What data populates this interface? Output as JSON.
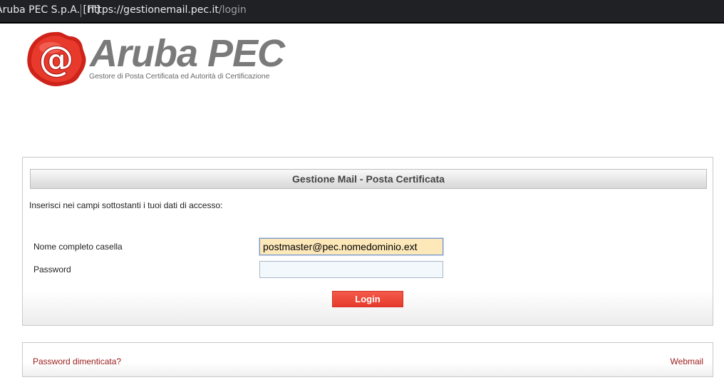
{
  "browser": {
    "site_name": "Aruba PEC S.p.A. [IT]",
    "url_host": "https://gestionemail.pec.it",
    "url_path": "/login"
  },
  "logo": {
    "icon": "aruba-seal-at-icon",
    "seal_glyph": "@",
    "wordmark": "Aruba PEC",
    "tagline": "Gestore di Posta Certificata ed Autorità di Certificazione",
    "seal_color": "#d9261c"
  },
  "login_panel": {
    "title": "Gestione Mail - Posta Certificata",
    "intro": "Inserisci nei campi sottostanti i tuoi dati di accesso:",
    "username_label": "Nome completo casella",
    "username_value": "postmaster@pec.nomedominio.ext",
    "password_label": "Password",
    "password_value": "",
    "login_button": "Login",
    "button_color": "#e8402f"
  },
  "footer": {
    "forgot_password": "Password dimenticata?",
    "webmail": "Webmail",
    "link_color": "#9b1b1b"
  }
}
